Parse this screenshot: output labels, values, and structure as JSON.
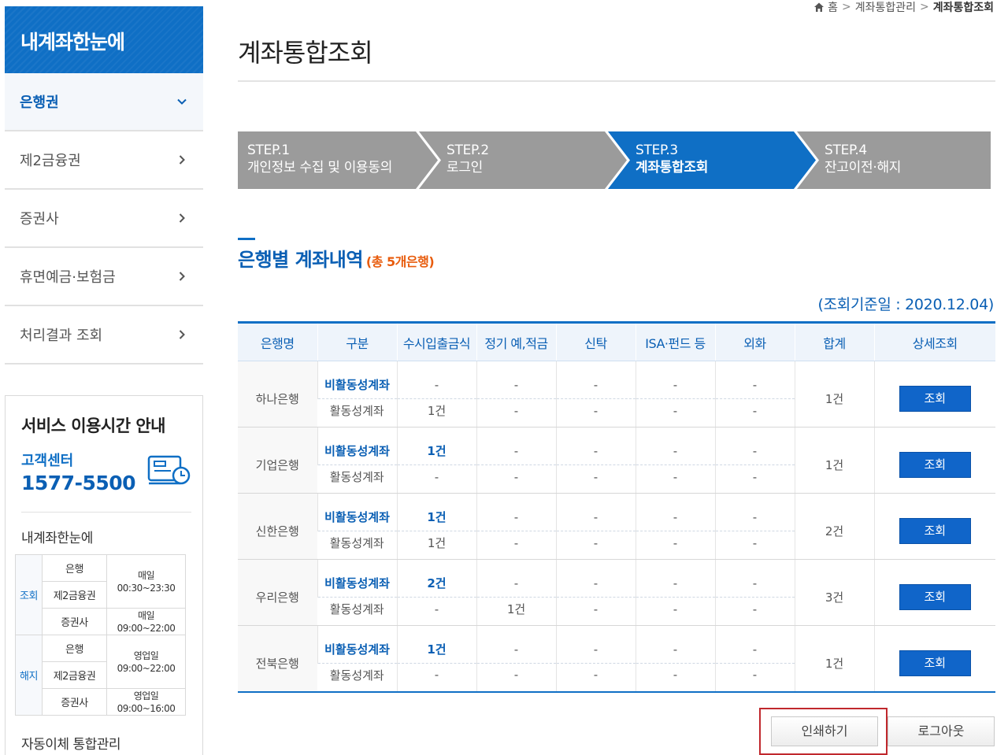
{
  "sidebar": {
    "title": "내계좌한눈에",
    "items": [
      {
        "label": "은행권",
        "active": true
      },
      {
        "label": "제2금융권"
      },
      {
        "label": "증권사"
      },
      {
        "label": "휴면예금·보험금"
      },
      {
        "label": "처리결과 조회"
      }
    ]
  },
  "info": {
    "title": "서비스 이용시간 안내",
    "cs_label": "고객센터",
    "cs_phone": "1577-5500",
    "subtitle": "내계좌한눈에",
    "lookup_label": "조회",
    "cancel_label": "해지",
    "lookup": {
      "bank": "은행",
      "second": "제2금융권",
      "stock": "증권사",
      "time1_day": "매일",
      "time1": "00:30~23:30",
      "time2_day": "매일",
      "time2": "09:00~22:00"
    },
    "cancel": {
      "bank": "은행",
      "second": "제2금융권",
      "stock": "증권사",
      "time1_day": "영업일",
      "time1": "09:00~22:00",
      "time2_day": "영업일",
      "time2": "09:00~16:00"
    },
    "footer": "자동이체 통합관리"
  },
  "breadcrumb": {
    "home": "홈",
    "parent": "계좌통합관리",
    "current": "계좌통합조회"
  },
  "page_title": "계좌통합조회",
  "steps": [
    {
      "num": "STEP.1",
      "label": "개인정보 수집 및 이용동의"
    },
    {
      "num": "STEP.2",
      "label": "로그인"
    },
    {
      "num": "STEP.3",
      "label": "계좌통합조회",
      "active": true
    },
    {
      "num": "STEP.4",
      "label": "잔고이전·해지"
    }
  ],
  "section": {
    "title": "은행별 계좌내역",
    "count": "(총 5개은행)",
    "ref_date": "(조회기준일 : 2020.12.04)"
  },
  "table": {
    "headers": [
      "은행명",
      "구분",
      "수시입출금식",
      "정기 예,적금",
      "신탁",
      "ISA·펀드 등",
      "외화",
      "합계",
      "상세조회"
    ],
    "inactive_label": "비활동성계좌",
    "active_label": "활동성계좌",
    "view_label": "조회",
    "rows": [
      {
        "bank": "하나은행",
        "inactive": [
          "-",
          "-",
          "-",
          "-",
          "-"
        ],
        "active": [
          "1건",
          "-",
          "-",
          "-",
          "-"
        ],
        "total": "1건"
      },
      {
        "bank": "기업은행",
        "inactive": [
          "1건",
          "-",
          "-",
          "-",
          "-"
        ],
        "active": [
          "-",
          "-",
          "-",
          "-",
          "-"
        ],
        "total": "1건"
      },
      {
        "bank": "신한은행",
        "inactive": [
          "1건",
          "-",
          "-",
          "-",
          "-"
        ],
        "active": [
          "1건",
          "-",
          "-",
          "-",
          "-"
        ],
        "total": "2건"
      },
      {
        "bank": "우리은행",
        "inactive": [
          "2건",
          "-",
          "-",
          "-",
          "-"
        ],
        "active": [
          "-",
          "1건",
          "-",
          "-",
          "-"
        ],
        "total": "3건"
      },
      {
        "bank": "전북은행",
        "inactive": [
          "1건",
          "-",
          "-",
          "-",
          "-"
        ],
        "active": [
          "-",
          "-",
          "-",
          "-",
          "-"
        ],
        "total": "1건"
      }
    ]
  },
  "buttons": {
    "print": "인쇄하기",
    "logout": "로그아웃"
  }
}
